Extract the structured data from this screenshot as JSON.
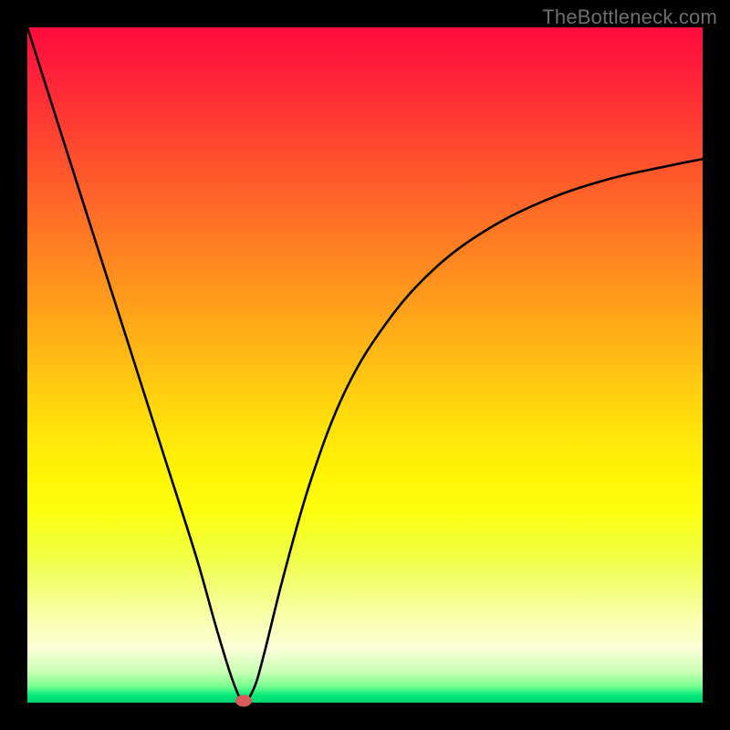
{
  "watermark": "TheBottleneck.com",
  "chart_data": {
    "type": "line",
    "title": "",
    "xlabel": "",
    "ylabel": "",
    "xlim": [
      0,
      100
    ],
    "ylim": [
      0,
      100
    ],
    "grid": false,
    "series": [
      {
        "name": "bottleneck-curve",
        "x": [
          0,
          5,
          10,
          15,
          20,
          25,
          28,
          30.5,
          32,
          33.5,
          35,
          38,
          42,
          47,
          53,
          60,
          68,
          77,
          86,
          94,
          100
        ],
        "y": [
          100,
          84.3,
          68.6,
          53.0,
          37.3,
          21.6,
          11.0,
          3.0,
          0.3,
          2.0,
          7.0,
          19.0,
          33.0,
          46.0,
          56.0,
          64.0,
          70.0,
          74.5,
          77.5,
          79.3,
          80.5
        ]
      }
    ],
    "marker": {
      "x": 32,
      "y": 0.3,
      "color": "#d95a5a"
    },
    "background_gradient": {
      "top": "#ff0a3c",
      "mid": "#ffd80a",
      "bottom": "#00d26c"
    }
  }
}
